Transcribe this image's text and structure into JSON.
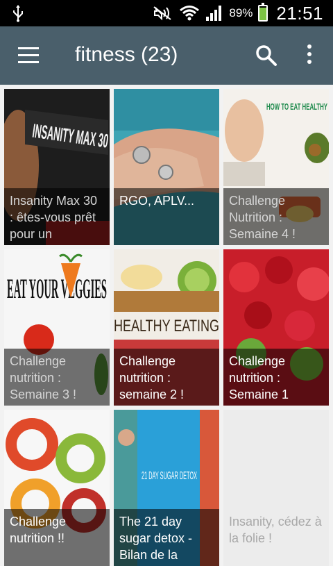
{
  "status_bar": {
    "battery_percent": "89%",
    "battery_level": 0.89,
    "time": "21:51",
    "icons": [
      "usb-icon",
      "mute-icon",
      "wifi-icon",
      "signal-icon",
      "battery-icon"
    ]
  },
  "app_bar": {
    "title": "fitness (23)",
    "icons": [
      "menu-icon",
      "search-icon",
      "more-vertical-icon"
    ]
  },
  "tiles": [
    {
      "title": "Insanity Max 30 : êtes-vous prêt pour un",
      "image_text": "INSANITY MAX 30",
      "image": "insanity-max-workout"
    },
    {
      "title": "RGO, APLV...",
      "image": "wrist-bracelet"
    },
    {
      "title": "Challenge Nutrition : Semaine 4 !",
      "image_text": "HOW TO EAT HEALTHY",
      "image": "healthy-food-thumbs-up"
    },
    {
      "title": "Challenge nutrition : Semaine 3 !",
      "image_text": "EAT YOUR VEGGIES",
      "image": "eat-your-veggies"
    },
    {
      "title": "Challenge nutrition : semaine 2 !",
      "image_text": "HEALTHY EATING",
      "image": "fruit-granola-bowl"
    },
    {
      "title": "Challenge nutrition : Semaine 1",
      "image": "berries-kiwi-bowl"
    },
    {
      "title": "Challenge nutrition !!",
      "image": "fruit-veg-letters"
    },
    {
      "title": "The 21 day sugar detox - Bilan de la",
      "image_text": "21 DAY SUGAR DETOX",
      "image": "sugar-detox-book"
    },
    {
      "title": "Insanity, cédez à la folie !",
      "image": "none"
    }
  ]
}
